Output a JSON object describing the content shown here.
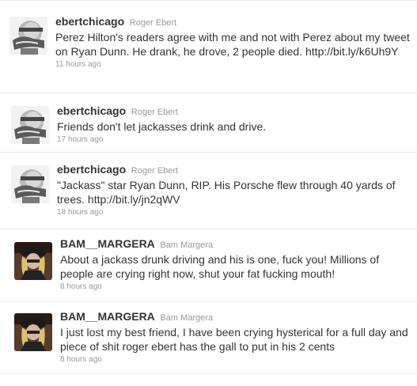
{
  "tweets": [
    {
      "screen_name": "ebertchicago",
      "full_name": "Roger Ebert",
      "text": "Perez Hilton's readers agree with me and not with Perez about my tweet on Ryan Dunn. He drank, he drove, 2 people died.",
      "link": "http://bit.ly/k6Uh9Y",
      "time": "11 hours ago"
    },
    {
      "screen_name": "ebertchicago",
      "full_name": "Roger Ebert",
      "text": "Friends don't let jackasses drink and drive.",
      "link": "",
      "time": "17 hours ago"
    },
    {
      "screen_name": "ebertchicago",
      "full_name": "Roger Ebert",
      "text": "\"Jackass\" star Ryan Dunn, RIP. His Porsche flew through 40 yards of trees.",
      "link": "http://bit.ly/jn2qWV",
      "time": "18 hours ago"
    },
    {
      "screen_name": "BAM__MARGERA",
      "full_name": "Bam Margera",
      "text": "About a jackass drunk driving and his is one, fuck you! Millions of people are crying right now, shut your fat fucking mouth!",
      "link": "",
      "time": "8 hours ago"
    },
    {
      "screen_name": "BAM__MARGERA",
      "full_name": "Bam Margera",
      "text": "I just lost my best friend, I have been crying hysterical for a full day and piece of shit roger ebert has the gall to put in his 2 cents",
      "link": "",
      "time": "8 hours ago"
    }
  ]
}
